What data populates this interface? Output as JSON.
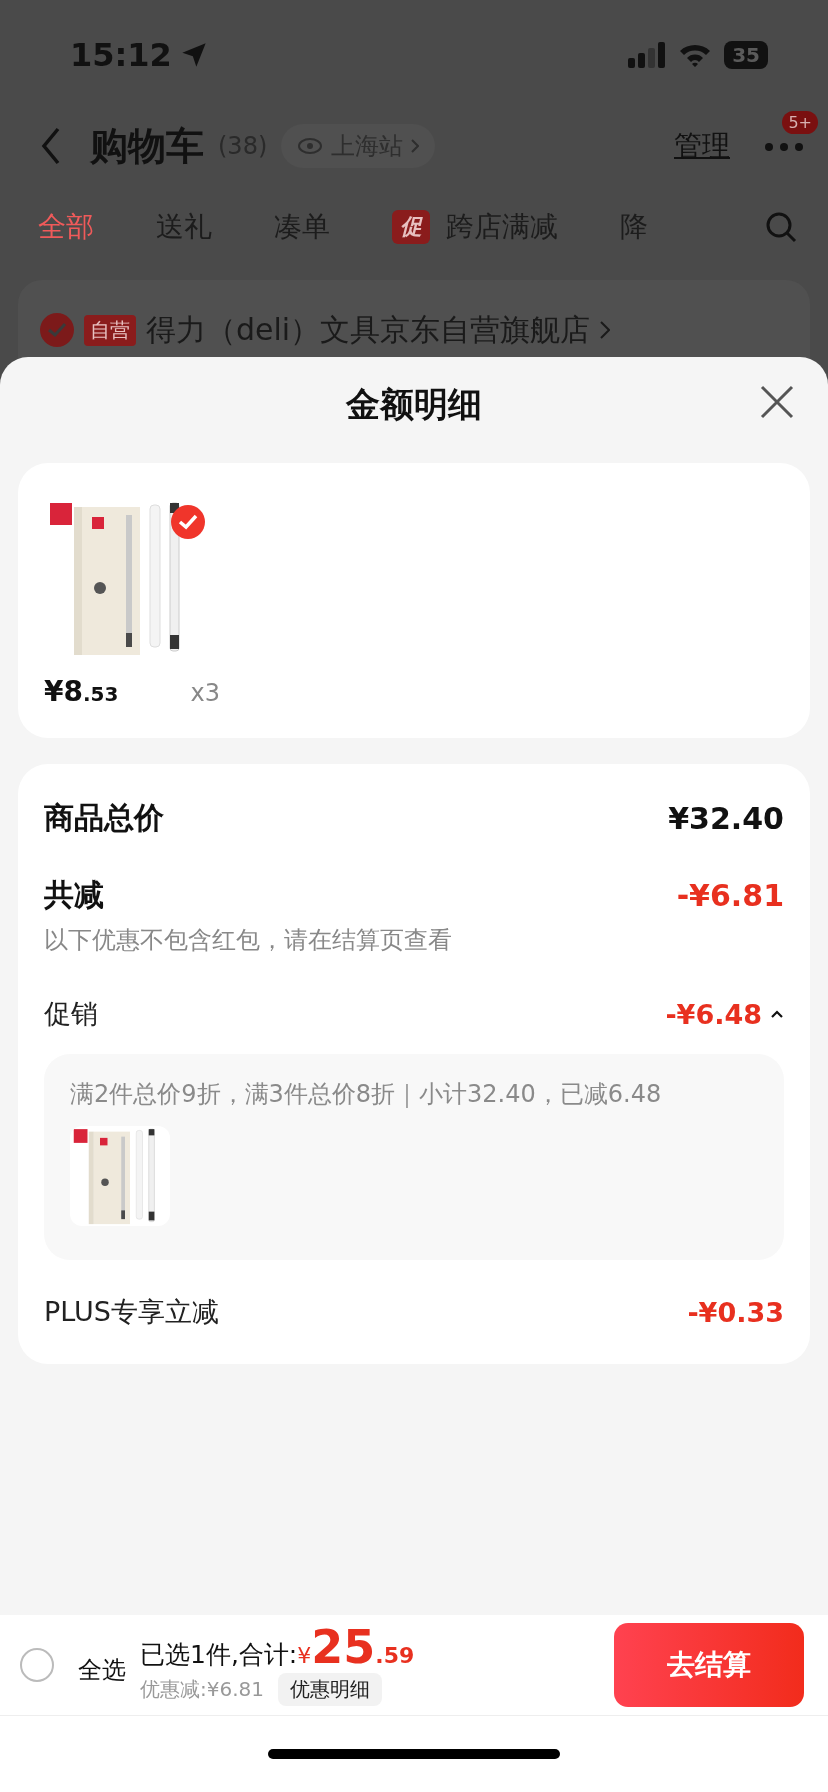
{
  "status_bar": {
    "time": "15:12",
    "battery": "35"
  },
  "header": {
    "title": "购物车",
    "count": "(38)",
    "location": "上海站",
    "manage": "管理",
    "badge": "5+"
  },
  "tabs": [
    {
      "label": "全部",
      "selected": true
    },
    {
      "label": "送礼",
      "selected": false
    },
    {
      "label": "凑单",
      "selected": false
    },
    {
      "label": "跨店满减",
      "selected": false,
      "tag": "促"
    },
    {
      "label": "降",
      "selected": false
    }
  ],
  "store": {
    "tag": "自营",
    "name": "得力（deli）文具京东自营旗舰店",
    "checked": true
  },
  "sheet": {
    "title": "金额明细",
    "items": [
      {
        "price_main": "¥8",
        "price_decimal": ".53",
        "quantity": "x3",
        "selected": true
      }
    ],
    "total": {
      "label": "商品总价",
      "value": "¥32.40"
    },
    "discount": {
      "label": "共减",
      "value": "-¥6.81",
      "note": "以下优惠不包含红包，请在结算页查看"
    },
    "promotions": [
      {
        "label": "促销",
        "value": "-¥6.48",
        "expanded": true,
        "detail": "满2件总价9折，满3件总价8折｜小计32.40，已减6.48"
      },
      {
        "label": "PLUS专享立减",
        "value": "-¥0.33"
      }
    ]
  },
  "footer": {
    "select_all": "全选",
    "select_all_checked": false,
    "summary": "已选1件,合计:",
    "currency": "¥",
    "total_main": "25",
    "total_decimal": ".59",
    "saved": "优惠减:¥6.81",
    "detail_button": "优惠明细",
    "checkout": "去结算"
  }
}
